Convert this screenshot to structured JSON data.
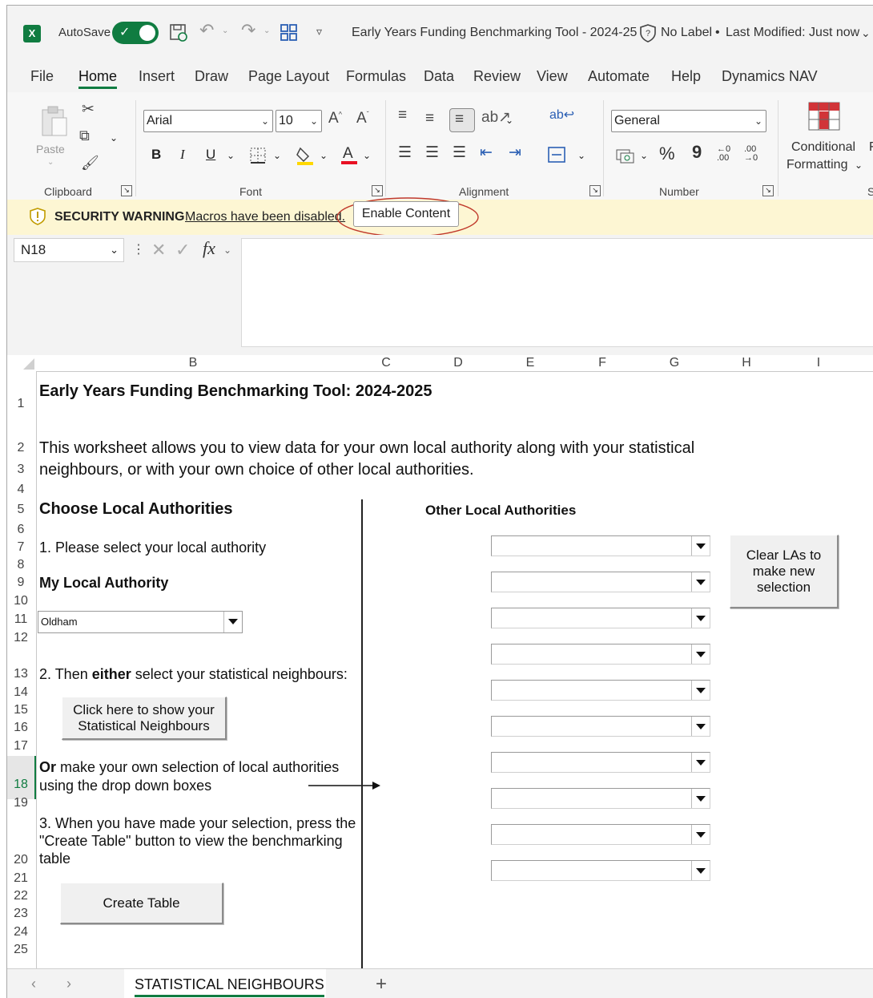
{
  "titlebar": {
    "autosave_label": "AutoSave",
    "document_title": "Early Years Funding Benchmarking Tool - 2024-25",
    "sensitivity_label": "No Label",
    "bullet": "•",
    "last_modified": "Last Modified: Just now"
  },
  "menu": {
    "tabs": [
      "File",
      "Home",
      "Insert",
      "Draw",
      "Page Layout",
      "Formulas",
      "Data",
      "Review",
      "View",
      "Automate",
      "Help",
      "Dynamics NAV"
    ]
  },
  "ribbon": {
    "paste_label": "Paste",
    "clipboard_label": "Clipboard",
    "font_name": "Arial",
    "font_size": "10",
    "font_label": "Font",
    "bold": "B",
    "italic": "I",
    "underline": "U",
    "alignment_label": "Alignment",
    "number_format": "General",
    "percent": "%",
    "comma": "9",
    "number_label": "Number",
    "conditional_line1": "Conditional",
    "conditional_line2": "Formatting",
    "cut_off_label": "F",
    "styles_cut": "S"
  },
  "security": {
    "title": "SECURITY WARNING",
    "message": "Macros have been disabled.",
    "button": "Enable Content"
  },
  "formula": {
    "name_box": "N18",
    "fx": "fx",
    "value": ""
  },
  "columns": [
    "B",
    "C",
    "D",
    "E",
    "F",
    "G",
    "H",
    "I"
  ],
  "rows": [
    "1",
    "2",
    "3",
    "4",
    "5",
    "6",
    "7",
    "8",
    "9",
    "10",
    "11",
    "12",
    "13",
    "14",
    "15",
    "16",
    "17",
    "18",
    "19",
    "20",
    "21",
    "22",
    "23",
    "24",
    "25"
  ],
  "sheet": {
    "title": "Early Years Funding Benchmarking Tool: 2024-2025",
    "intro_line1": "This worksheet allows you to view data for your own local authority along with your statistical",
    "intro_line2": "neighbours, or with your own choice of other local authorities.",
    "choose_heading": "Choose Local Authorities",
    "step1": "1. Please select your local authority",
    "my_la_heading": "My Local Authority",
    "selected_la": "Oldham",
    "step2_prefix": "2. Then",
    "step2_bold": "either",
    "step2_suffix": "select your statistical neighbours:",
    "show_neighbours_btn_line1": "Click here to show your",
    "show_neighbours_btn_line2": "Statistical Neighbours",
    "or_bold": "Or",
    "or_line1_rest": "make your own selection of local authorities",
    "or_line2": "using the drop down boxes",
    "step3_line1": "3. When you have made your selection, press the",
    "step3_line2": "\"Create Table\" button to view the benchmarking",
    "step3_line3": "table",
    "create_table_btn": "Create Table",
    "other_las_heading": "Other Local Authorities",
    "clear_btn_line1": "Clear LAs to",
    "clear_btn_line2": "make new",
    "clear_btn_line3": "selection",
    "other_la_values": [
      "",
      "",
      "",
      "",
      "",
      "",
      "",
      "",
      "",
      ""
    ]
  },
  "tabs": {
    "active_sheet": "STATISTICAL NEIGHBOURS",
    "add": "+"
  }
}
